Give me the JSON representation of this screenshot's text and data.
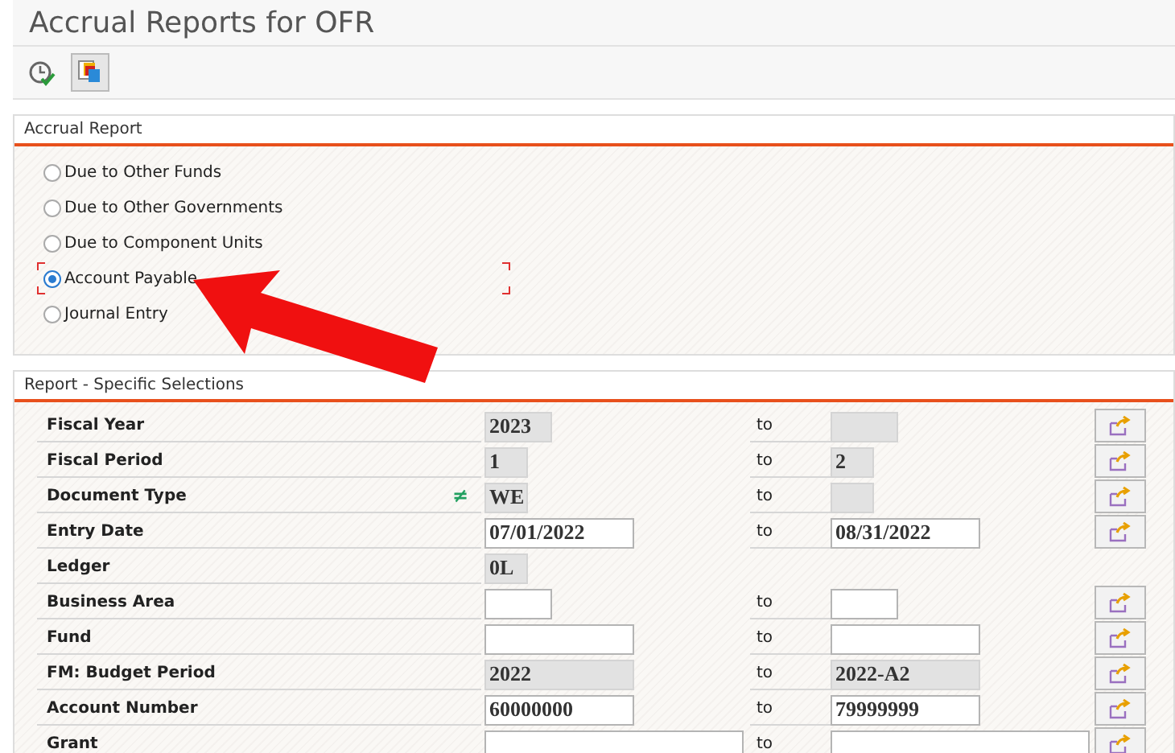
{
  "window": {
    "title": "Accrual Reports for OFR"
  },
  "toolbar": [
    {
      "kind": "execute",
      "pressed": false
    },
    {
      "kind": "layers",
      "pressed": true
    }
  ],
  "accrual_report": {
    "title": "Accrual Report",
    "options": [
      {
        "label": "Due to Other Funds",
        "selected": false,
        "focused": false
      },
      {
        "label": "Due to Other Governments",
        "selected": false,
        "focused": false
      },
      {
        "label": "Due to Component Units",
        "selected": false,
        "focused": false
      },
      {
        "label": "Account Payable",
        "selected": true,
        "focused": true
      },
      {
        "label": "Journal Entry",
        "selected": false,
        "focused": false
      }
    ]
  },
  "annotation": {
    "kind": "arrow"
  },
  "selections": {
    "title": "Report - Specific Selections",
    "rows": [
      {
        "label": "Fiscal Year",
        "low": {
          "value": "2023",
          "kind": "short",
          "disabled": true
        },
        "to": "to",
        "high": {
          "kind": "short",
          "disabled": true
        },
        "multiple": true
      },
      {
        "label": "Fiscal Period",
        "low": {
          "value": "1",
          "kind": "tiny",
          "disabled": true
        },
        "to": "to",
        "high": {
          "value": "2",
          "kind": "tiny",
          "disabled": true
        },
        "multiple": true
      },
      {
        "label": "Document Type",
        "operator": "≠",
        "low": {
          "value": "WE",
          "kind": "tiny",
          "disabled": true
        },
        "to": "to",
        "high": {
          "kind": "tiny",
          "disabled": true
        },
        "multiple": true
      },
      {
        "label": "Entry Date",
        "low": {
          "value": "07/01/2022",
          "kind": "medium",
          "disabled": false
        },
        "to": "to",
        "high": {
          "value": "08/31/2022",
          "kind": "medium",
          "disabled": false
        },
        "multiple": true
      },
      {
        "label": "Ledger",
        "low": {
          "value": "0L",
          "kind": "tiny",
          "disabled": true
        },
        "multiple": false
      },
      {
        "label": "Business Area",
        "low": {
          "kind": "short",
          "disabled": false
        },
        "to": "to",
        "high": {
          "kind": "short",
          "disabled": false
        },
        "multiple": true
      },
      {
        "label": "Fund",
        "low": {
          "kind": "medium",
          "disabled": false
        },
        "to": "to",
        "high": {
          "kind": "medium",
          "disabled": false
        },
        "multiple": true
      },
      {
        "label": "FM: Budget Period",
        "low": {
          "value": "2022",
          "kind": "medium",
          "disabled": true
        },
        "to": "to",
        "high": {
          "value": "2022-A2",
          "kind": "medium",
          "disabled": true
        },
        "multiple": true
      },
      {
        "label": "Account Number",
        "low": {
          "value": "60000000",
          "kind": "medium",
          "disabled": false
        },
        "to": "to",
        "high": {
          "value": "79999999",
          "kind": "medium",
          "disabled": false
        },
        "multiple": true
      },
      {
        "label": "Grant",
        "low": {
          "kind": "long",
          "disabled": false
        },
        "to": "to",
        "high": {
          "kind": "long",
          "disabled": false
        },
        "multiple": true
      }
    ]
  }
}
